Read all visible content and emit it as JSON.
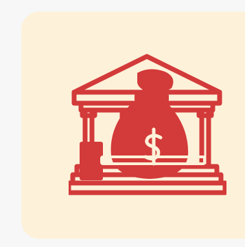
{
  "icon": {
    "name": "bank-money-bag-icon",
    "currency_symbol": "$"
  },
  "colors": {
    "background": "#f6f7f6",
    "tile": "#fdf1d9",
    "icon": "#d33a3a"
  }
}
